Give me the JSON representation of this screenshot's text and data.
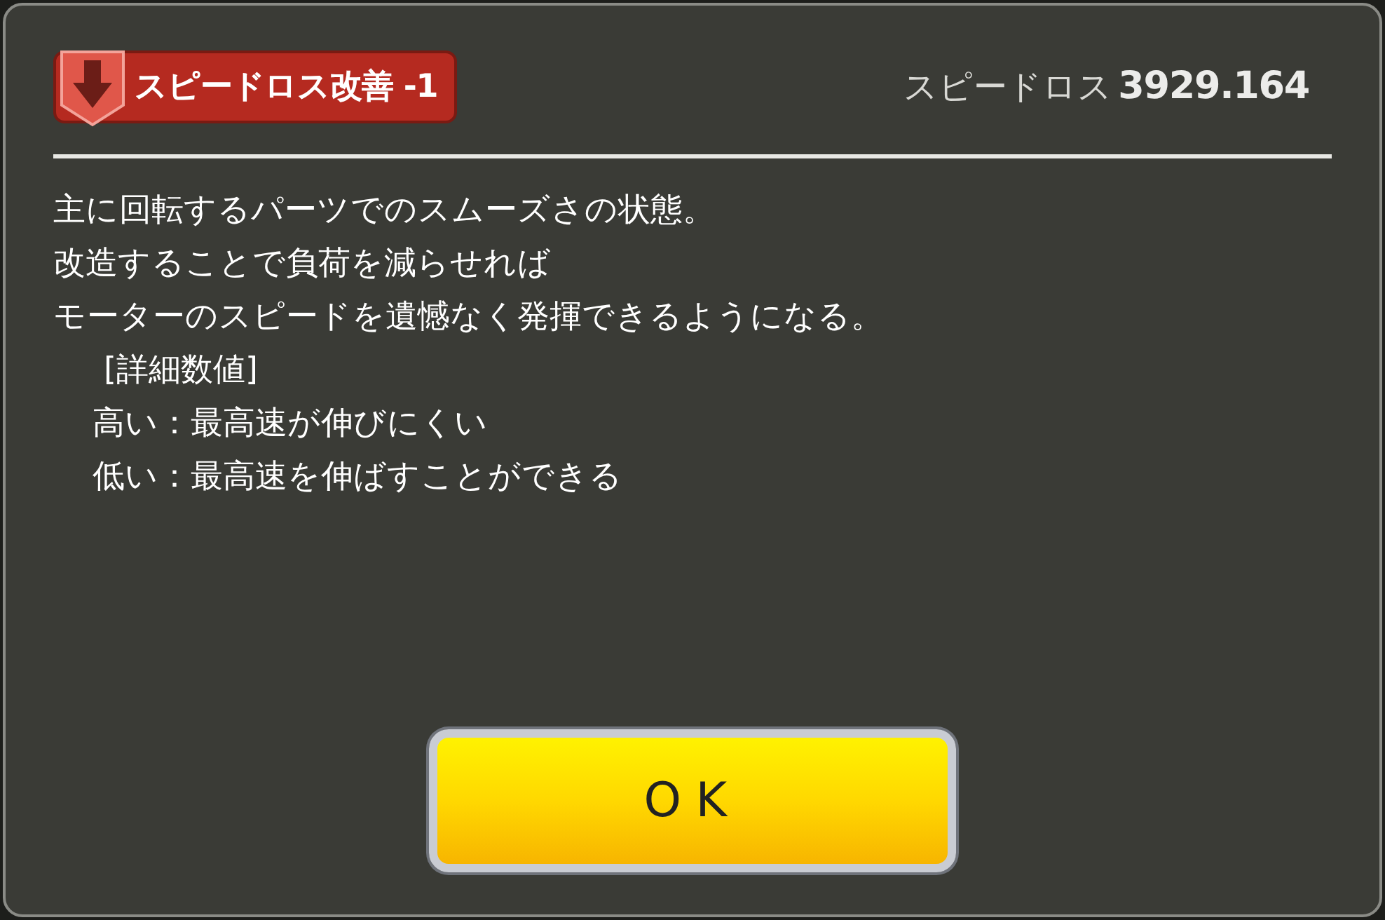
{
  "header": {
    "badge": {
      "label": "スピードロス改善 -1",
      "kind": "decrease"
    },
    "stat": {
      "label": "スピードロス",
      "value": "3929.164"
    }
  },
  "description": [
    "主に回転するパーツでのスムーズさの状態。",
    "改造することで負荷を減らせれば",
    "モーターのスピードを遺憾なく発揮できるようになる。"
  ],
  "details": {
    "title": "[詳細数値]",
    "items": [
      "高い：最高速が伸びにくい",
      "低い：最高速を伸ばすことができる"
    ]
  },
  "button": {
    "label": "OK"
  }
}
